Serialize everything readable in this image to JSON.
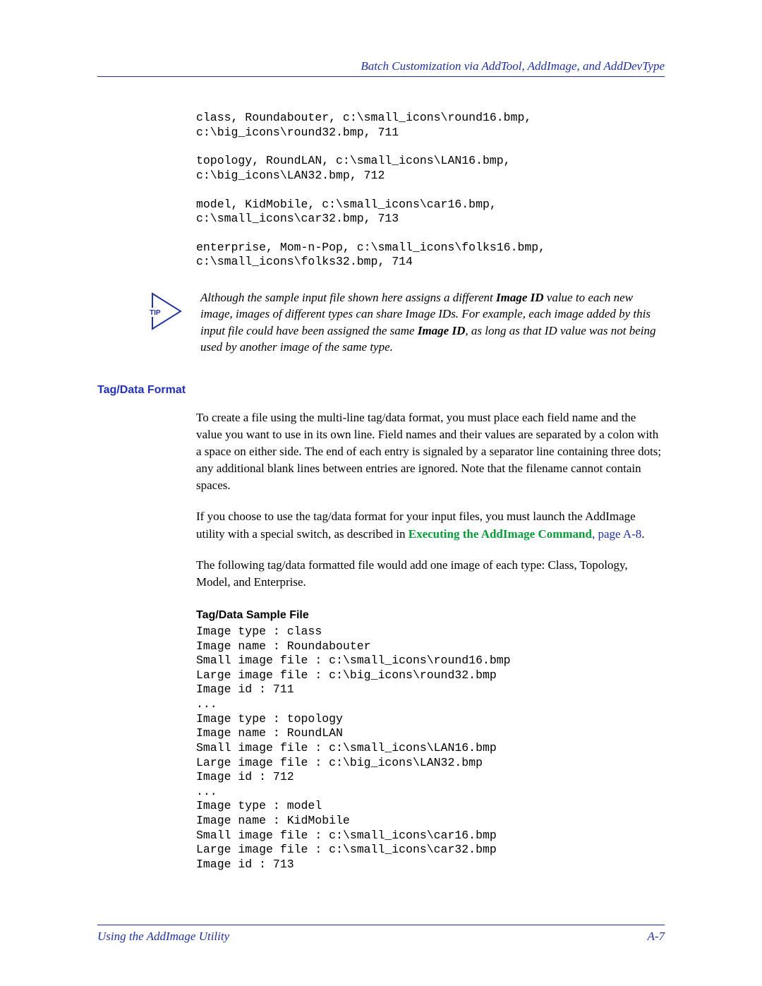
{
  "header": {
    "title": "Batch Customization via AddTool, AddImage, and AddDevType"
  },
  "code_blocks": [
    "class, Roundabouter, c:\\small_icons\\round16.bmp,\nc:\\big_icons\\round32.bmp, 711",
    "topology, RoundLAN, c:\\small_icons\\LAN16.bmp,\nc:\\big_icons\\LAN32.bmp, 712",
    "model, KidMobile, c:\\small_icons\\car16.bmp,\nc:\\small_icons\\car32.bmp, 713",
    "enterprise, Mom-n-Pop, c:\\small_icons\\folks16.bmp,\nc:\\small_icons\\folks32.bmp, 714"
  ],
  "tip": {
    "label": "TIP",
    "pre": "Although the sample input file shown here assigns a different ",
    "bold1": "Image ID",
    "mid": " value to each new image, images of different types can share Image IDs. For example, each image added by this input file could have been assigned the same ",
    "bold2": "Image ID",
    "post": ", as long as that ID value was not being used by another image of the same type."
  },
  "section": {
    "heading": "Tag/Data Format",
    "p1": "To create a file using the multi-line tag/data format, you must place each field name and the value you want to use in its own line. Field names and their values are separated by a colon with a space on either side. The end of each entry is signaled by a separator line containing three dots; any additional blank lines between entries are ignored. Note that the filename cannot contain spaces.",
    "p2_pre": "If you choose to use the tag/data format for your input files, you must launch the AddImage utility with a special switch, as described in ",
    "p2_link": "Executing the AddImage Command",
    "p2_sep": ", ",
    "p2_ref": "page A-8",
    "p2_post": ".",
    "p3": "The following tag/data formatted file would add one image of each type: Class, Topology, Model, and Enterprise.",
    "sample_heading": "Tag/Data Sample File",
    "sample_code": "Image type : class\nImage name : Roundabouter\nSmall image file : c:\\small_icons\\round16.bmp\nLarge image file : c:\\big_icons\\round32.bmp\nImage id : 711\n...\nImage type : topology\nImage name : RoundLAN\nSmall image file : c:\\small_icons\\LAN16.bmp\nLarge image file : c:\\big_icons\\LAN32.bmp\nImage id : 712\n...\nImage type : model\nImage name : KidMobile\nSmall image file : c:\\small_icons\\car16.bmp\nLarge image file : c:\\small_icons\\car32.bmp\nImage id : 713"
  },
  "footer": {
    "left": "Using the AddImage Utility",
    "right": "A-7"
  }
}
